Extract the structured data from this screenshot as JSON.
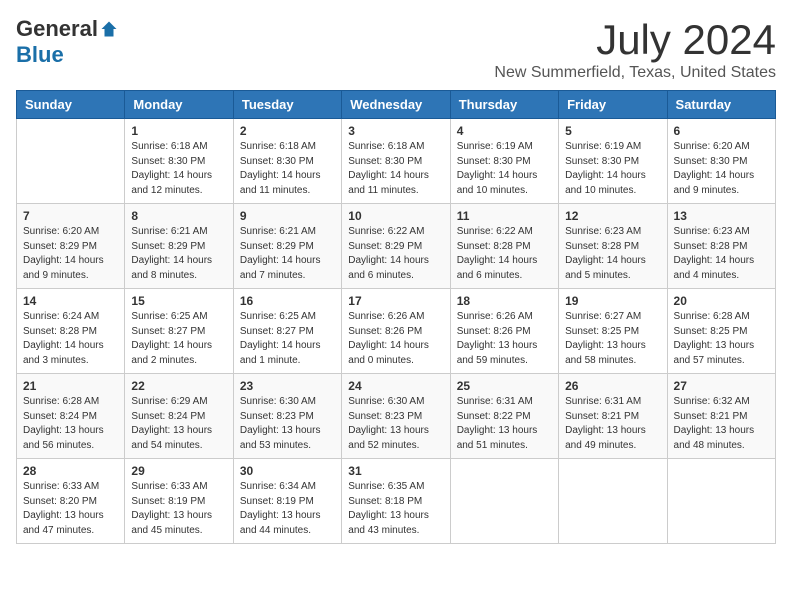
{
  "header": {
    "logo_general": "General",
    "logo_blue": "Blue",
    "title": "July 2024",
    "subtitle": "New Summerfield, Texas, United States"
  },
  "calendar": {
    "days_of_week": [
      "Sunday",
      "Monday",
      "Tuesday",
      "Wednesday",
      "Thursday",
      "Friday",
      "Saturday"
    ],
    "weeks": [
      [
        {
          "day": "",
          "sunrise": "",
          "sunset": "",
          "daylight": ""
        },
        {
          "day": "1",
          "sunrise": "Sunrise: 6:18 AM",
          "sunset": "Sunset: 8:30 PM",
          "daylight": "Daylight: 14 hours and 12 minutes."
        },
        {
          "day": "2",
          "sunrise": "Sunrise: 6:18 AM",
          "sunset": "Sunset: 8:30 PM",
          "daylight": "Daylight: 14 hours and 11 minutes."
        },
        {
          "day": "3",
          "sunrise": "Sunrise: 6:18 AM",
          "sunset": "Sunset: 8:30 PM",
          "daylight": "Daylight: 14 hours and 11 minutes."
        },
        {
          "day": "4",
          "sunrise": "Sunrise: 6:19 AM",
          "sunset": "Sunset: 8:30 PM",
          "daylight": "Daylight: 14 hours and 10 minutes."
        },
        {
          "day": "5",
          "sunrise": "Sunrise: 6:19 AM",
          "sunset": "Sunset: 8:30 PM",
          "daylight": "Daylight: 14 hours and 10 minutes."
        },
        {
          "day": "6",
          "sunrise": "Sunrise: 6:20 AM",
          "sunset": "Sunset: 8:30 PM",
          "daylight": "Daylight: 14 hours and 9 minutes."
        }
      ],
      [
        {
          "day": "7",
          "sunrise": "Sunrise: 6:20 AM",
          "sunset": "Sunset: 8:29 PM",
          "daylight": "Daylight: 14 hours and 9 minutes."
        },
        {
          "day": "8",
          "sunrise": "Sunrise: 6:21 AM",
          "sunset": "Sunset: 8:29 PM",
          "daylight": "Daylight: 14 hours and 8 minutes."
        },
        {
          "day": "9",
          "sunrise": "Sunrise: 6:21 AM",
          "sunset": "Sunset: 8:29 PM",
          "daylight": "Daylight: 14 hours and 7 minutes."
        },
        {
          "day": "10",
          "sunrise": "Sunrise: 6:22 AM",
          "sunset": "Sunset: 8:29 PM",
          "daylight": "Daylight: 14 hours and 6 minutes."
        },
        {
          "day": "11",
          "sunrise": "Sunrise: 6:22 AM",
          "sunset": "Sunset: 8:28 PM",
          "daylight": "Daylight: 14 hours and 6 minutes."
        },
        {
          "day": "12",
          "sunrise": "Sunrise: 6:23 AM",
          "sunset": "Sunset: 8:28 PM",
          "daylight": "Daylight: 14 hours and 5 minutes."
        },
        {
          "day": "13",
          "sunrise": "Sunrise: 6:23 AM",
          "sunset": "Sunset: 8:28 PM",
          "daylight": "Daylight: 14 hours and 4 minutes."
        }
      ],
      [
        {
          "day": "14",
          "sunrise": "Sunrise: 6:24 AM",
          "sunset": "Sunset: 8:28 PM",
          "daylight": "Daylight: 14 hours and 3 minutes."
        },
        {
          "day": "15",
          "sunrise": "Sunrise: 6:25 AM",
          "sunset": "Sunset: 8:27 PM",
          "daylight": "Daylight: 14 hours and 2 minutes."
        },
        {
          "day": "16",
          "sunrise": "Sunrise: 6:25 AM",
          "sunset": "Sunset: 8:27 PM",
          "daylight": "Daylight: 14 hours and 1 minute."
        },
        {
          "day": "17",
          "sunrise": "Sunrise: 6:26 AM",
          "sunset": "Sunset: 8:26 PM",
          "daylight": "Daylight: 14 hours and 0 minutes."
        },
        {
          "day": "18",
          "sunrise": "Sunrise: 6:26 AM",
          "sunset": "Sunset: 8:26 PM",
          "daylight": "Daylight: 13 hours and 59 minutes."
        },
        {
          "day": "19",
          "sunrise": "Sunrise: 6:27 AM",
          "sunset": "Sunset: 8:25 PM",
          "daylight": "Daylight: 13 hours and 58 minutes."
        },
        {
          "day": "20",
          "sunrise": "Sunrise: 6:28 AM",
          "sunset": "Sunset: 8:25 PM",
          "daylight": "Daylight: 13 hours and 57 minutes."
        }
      ],
      [
        {
          "day": "21",
          "sunrise": "Sunrise: 6:28 AM",
          "sunset": "Sunset: 8:24 PM",
          "daylight": "Daylight: 13 hours and 56 minutes."
        },
        {
          "day": "22",
          "sunrise": "Sunrise: 6:29 AM",
          "sunset": "Sunset: 8:24 PM",
          "daylight": "Daylight: 13 hours and 54 minutes."
        },
        {
          "day": "23",
          "sunrise": "Sunrise: 6:30 AM",
          "sunset": "Sunset: 8:23 PM",
          "daylight": "Daylight: 13 hours and 53 minutes."
        },
        {
          "day": "24",
          "sunrise": "Sunrise: 6:30 AM",
          "sunset": "Sunset: 8:23 PM",
          "daylight": "Daylight: 13 hours and 52 minutes."
        },
        {
          "day": "25",
          "sunrise": "Sunrise: 6:31 AM",
          "sunset": "Sunset: 8:22 PM",
          "daylight": "Daylight: 13 hours and 51 minutes."
        },
        {
          "day": "26",
          "sunrise": "Sunrise: 6:31 AM",
          "sunset": "Sunset: 8:21 PM",
          "daylight": "Daylight: 13 hours and 49 minutes."
        },
        {
          "day": "27",
          "sunrise": "Sunrise: 6:32 AM",
          "sunset": "Sunset: 8:21 PM",
          "daylight": "Daylight: 13 hours and 48 minutes."
        }
      ],
      [
        {
          "day": "28",
          "sunrise": "Sunrise: 6:33 AM",
          "sunset": "Sunset: 8:20 PM",
          "daylight": "Daylight: 13 hours and 47 minutes."
        },
        {
          "day": "29",
          "sunrise": "Sunrise: 6:33 AM",
          "sunset": "Sunset: 8:19 PM",
          "daylight": "Daylight: 13 hours and 45 minutes."
        },
        {
          "day": "30",
          "sunrise": "Sunrise: 6:34 AM",
          "sunset": "Sunset: 8:19 PM",
          "daylight": "Daylight: 13 hours and 44 minutes."
        },
        {
          "day": "31",
          "sunrise": "Sunrise: 6:35 AM",
          "sunset": "Sunset: 8:18 PM",
          "daylight": "Daylight: 13 hours and 43 minutes."
        },
        {
          "day": "",
          "sunrise": "",
          "sunset": "",
          "daylight": ""
        },
        {
          "day": "",
          "sunrise": "",
          "sunset": "",
          "daylight": ""
        },
        {
          "day": "",
          "sunrise": "",
          "sunset": "",
          "daylight": ""
        }
      ]
    ]
  }
}
